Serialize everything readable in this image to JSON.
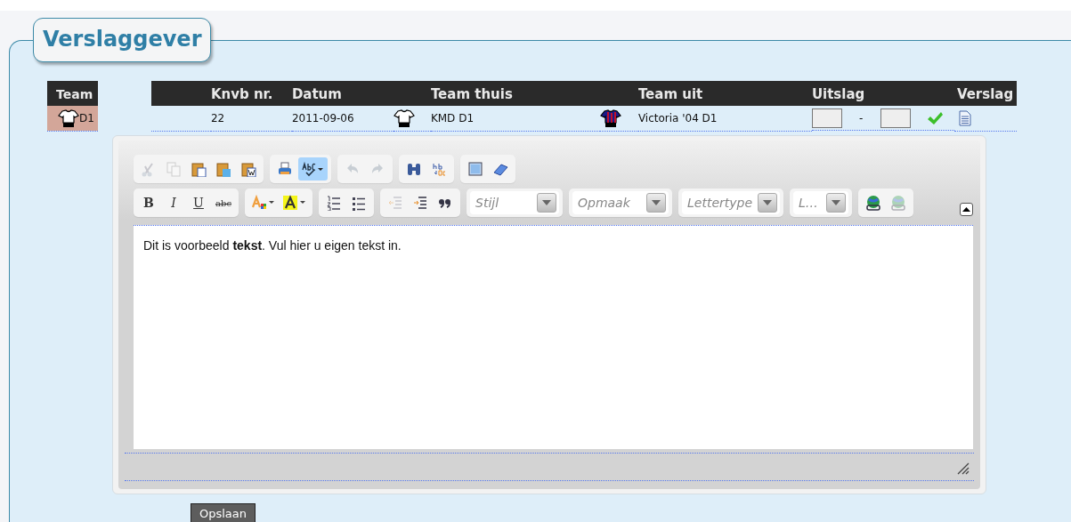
{
  "panel": {
    "title": "Verslaggever"
  },
  "team_table": {
    "header": "Team",
    "rows": [
      {
        "team": "D1",
        "selected": true
      }
    ]
  },
  "matches": {
    "columns": [
      "Knvb nr.",
      "Datum",
      "Team thuis",
      "Team uit",
      "Uitslag",
      "Verslag"
    ],
    "rows": [
      {
        "knvb_nr": "22",
        "datum": "2011-09-06",
        "team_thuis": "KMD D1",
        "team_uit": "Victoria '04 D1",
        "separator": "-",
        "confirmed": true
      }
    ]
  },
  "editor": {
    "toolbar": [
      [
        [
          {
            "kind": "icon",
            "disabled": true
          },
          {
            "kind": "icon",
            "disabled": true
          },
          {
            "kind": "icon",
            "disabled": false
          },
          {
            "kind": "icon",
            "disabled": false
          },
          {
            "kind": "icon",
            "disabled": false
          }
        ],
        [
          {
            "kind": "icon",
            "disabled": false
          },
          {
            "kind": "menu",
            "disabled": false,
            "selected": true
          }
        ],
        [
          {
            "kind": "icon",
            "disabled": true
          },
          {
            "kind": "icon",
            "disabled": true
          }
        ],
        [
          {
            "kind": "icon",
            "disabled": false
          },
          {
            "kind": "icon",
            "disabled": false
          }
        ],
        [
          {
            "kind": "icon",
            "disabled": false
          },
          {
            "kind": "icon",
            "disabled": false
          }
        ]
      ],
      [
        [
          {
            "kind": "text",
            "label": "B",
            "disabled": false
          },
          {
            "kind": "text",
            "label": "I",
            "disabled": false
          },
          {
            "kind": "text",
            "label": "U",
            "disabled": false
          },
          {
            "kind": "text",
            "label": "abc",
            "disabled": false
          }
        ],
        [
          {
            "kind": "menu",
            "disabled": false,
            "selected": false
          },
          {
            "kind": "menu",
            "disabled": false,
            "selected": false
          }
        ],
        [
          {
            "kind": "icon",
            "disabled": false
          },
          {
            "kind": "icon",
            "disabled": false
          }
        ],
        [
          {
            "kind": "icon",
            "disabled": true
          },
          {
            "kind": "icon",
            "disabled": false
          },
          {
            "kind": "icon",
            "disabled": false
          }
        ],
        [
          {
            "kind": "combo",
            "placeholder": "Stijl"
          }
        ],
        [
          {
            "kind": "combo",
            "placeholder": "Opmaak"
          }
        ],
        [
          {
            "kind": "combo",
            "placeholder": "Lettertype"
          }
        ],
        [
          {
            "kind": "combo",
            "placeholder": "L…"
          }
        ],
        [
          {
            "kind": "icon",
            "disabled": false
          },
          {
            "kind": "icon",
            "disabled": true
          }
        ]
      ]
    ],
    "content": "Dit is voorbeeld **tekst**. Vul hier u eigen tekst in."
  },
  "save_button": "Opslaan"
}
